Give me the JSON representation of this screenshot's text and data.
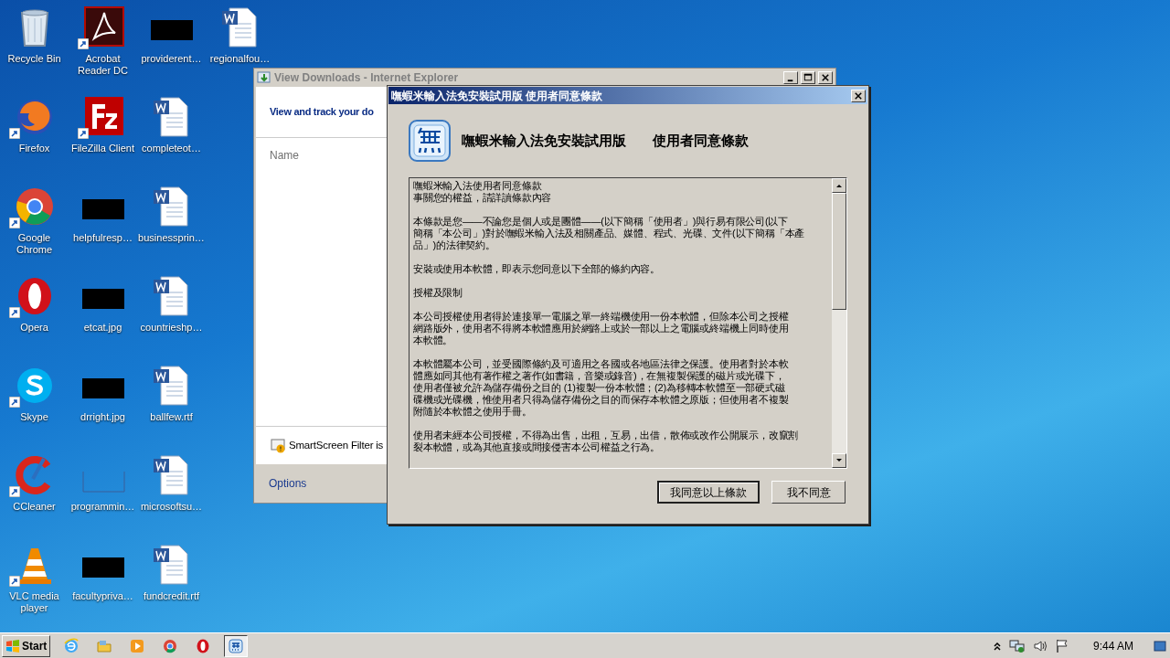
{
  "desktop_icons": [
    {
      "label": "Recycle Bin",
      "kind": "recycle",
      "shortcut": false
    },
    {
      "label": "Firefox",
      "kind": "firefox",
      "shortcut": true
    },
    {
      "label": "Google Chrome",
      "kind": "chrome",
      "shortcut": true
    },
    {
      "label": "Opera",
      "kind": "opera",
      "shortcut": true
    },
    {
      "label": "Skype",
      "kind": "skype",
      "shortcut": true
    },
    {
      "label": "CCleaner",
      "kind": "ccleaner",
      "shortcut": true
    },
    {
      "label": "VLC media player",
      "kind": "vlc",
      "shortcut": true
    },
    {
      "label": "Acrobat Reader DC",
      "kind": "acrobat",
      "shortcut": true
    },
    {
      "label": "FileZilla Client",
      "kind": "filezilla",
      "shortcut": true
    },
    {
      "label": "helpfulresp…",
      "kind": "thumb",
      "shortcut": false
    },
    {
      "label": "etcat.jpg",
      "kind": "thumb",
      "shortcut": false
    },
    {
      "label": "drright.jpg",
      "kind": "thumb",
      "shortcut": false
    },
    {
      "label": "programmin…",
      "kind": "blank",
      "shortcut": false
    },
    {
      "label": "facultypriva…",
      "kind": "thumb",
      "shortcut": false
    },
    {
      "label": "providerent…",
      "kind": "thumb",
      "shortcut": false
    },
    {
      "label": "completeot…",
      "kind": "word",
      "shortcut": false
    },
    {
      "label": "businessprin…",
      "kind": "word",
      "shortcut": false
    },
    {
      "label": "countrieshp…",
      "kind": "word",
      "shortcut": false
    },
    {
      "label": "ballfew.rtf",
      "kind": "word",
      "shortcut": false
    },
    {
      "label": "microsoftsu…",
      "kind": "word",
      "shortcut": false
    },
    {
      "label": "fundcredit.rtf",
      "kind": "word",
      "shortcut": false
    },
    {
      "label": "regionalfou…",
      "kind": "word",
      "shortcut": false
    }
  ],
  "ie_window": {
    "title": "View Downloads - Internet Explorer",
    "header": "View and track your do",
    "column": "Name",
    "notice": "SmartScreen Filter is",
    "options": "Options"
  },
  "dialog": {
    "title": "嘸蝦米輸入法免安裝試用版 使用者同意條款",
    "heading": [
      "嘸蝦米輸入法免安裝試用版",
      "使用者同意條款"
    ],
    "paragraphs": [
      [
        "嘸蝦米輸入法使用者同意條款",
        "事關您的權益，請詳讀條款內容"
      ],
      [
        "本條款是您——不論您是個人或是團體——(以下簡稱「使用者」)與行易有限公司(以下",
        "簡稱「本公司」)對於嘸蝦米輸入法及相關產品、媒體、程式、光碟、文件(以下簡稱「本產",
        "品」)的法律契約。"
      ],
      [
        "安裝或使用本軟體，即表示您同意以下全部的條約內容。"
      ],
      [
        "授權及限制"
      ],
      [
        "本公司授權使用者得於連接單一電腦之單一終端機使用一份本軟體，但除本公司之授權",
        "網路版外，使用者不得將本軟體應用於網路上或於一部以上之電腦或終端機上同時使用",
        "本軟體。"
      ],
      [
        "本軟體屬本公司，並受國際條約及可適用之各國或各地區法律之保護。使用者對於本軟",
        "體應如同其他有著作權之著作(如書籍，音樂或錄音)，在無複製保護的磁片或光碟下，",
        "使用者僅被允許為儲存備份之目的 (1)複製一份本軟體；(2)為移轉本軟體至一部硬式磁",
        "碟機或光碟機，惟使用者只得為儲存備份之目的而保存本軟體之原版；但使用者不複製",
        "附隨於本軟體之使用手冊。"
      ],
      [
        "使用者未經本公司授權，不得為出售，出租，互易，出借，散佈或改作公開展示，改竄割",
        "裂本軟體，或為其他直接或間接侵害本公司權益之行為。"
      ]
    ],
    "buttons": [
      {
        "label": "我同意以上條款",
        "default": true
      },
      {
        "label": "我不同意",
        "default": false
      }
    ]
  },
  "taskbar": {
    "start": "Start",
    "items": [
      {
        "kind": "ie",
        "selected": false
      },
      {
        "kind": "explorer",
        "selected": false
      },
      {
        "kind": "media",
        "selected": false
      },
      {
        "kind": "chrome",
        "selected": false
      },
      {
        "kind": "opera",
        "selected": false
      },
      {
        "kind": "ime",
        "selected": true
      }
    ],
    "clock": "9:44 AM"
  }
}
